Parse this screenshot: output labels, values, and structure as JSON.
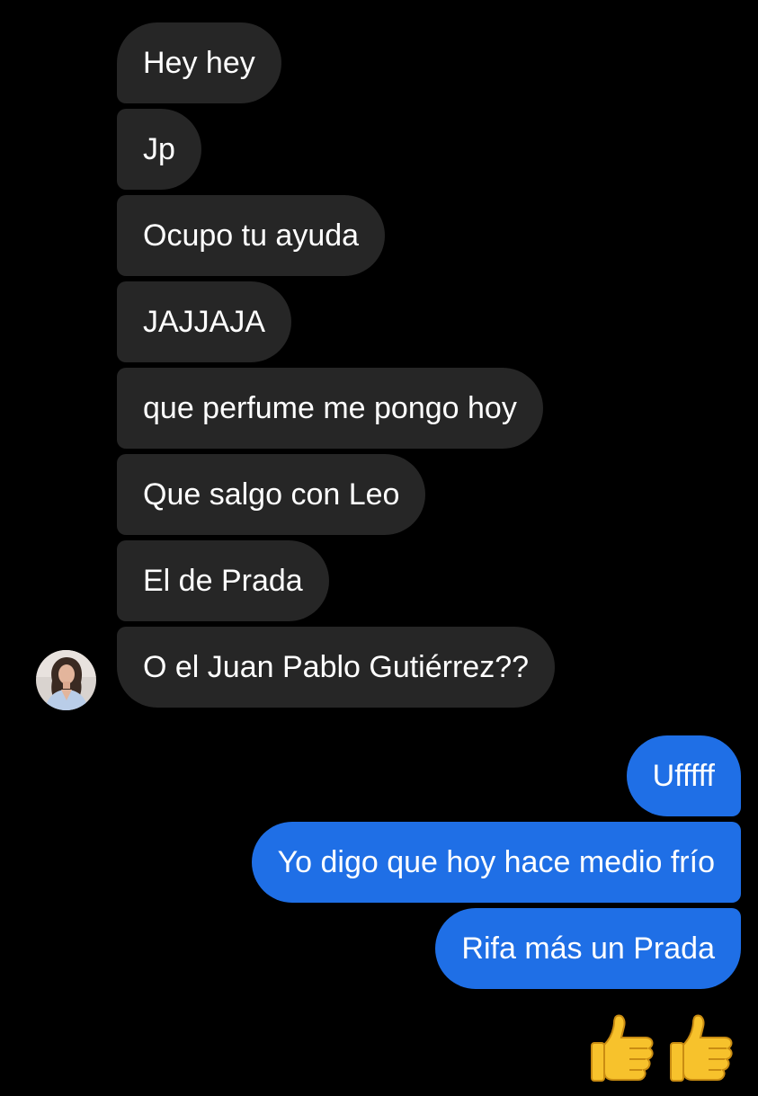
{
  "conversation": {
    "incoming": [
      {
        "text": "Hey hey"
      },
      {
        "text": "Jp"
      },
      {
        "text": "Ocupo tu ayuda"
      },
      {
        "text": "JAJJAJA"
      },
      {
        "text": "que perfume me pongo hoy"
      },
      {
        "text": "Que salgo con Leo"
      },
      {
        "text": "El de Prada"
      },
      {
        "text": "O el Juan Pablo Gutiérrez??"
      }
    ],
    "outgoing": [
      {
        "text": "Ufffff"
      },
      {
        "text": "Yo digo que hoy hace medio frío"
      },
      {
        "text": "Rifa más un Prada"
      }
    ],
    "reaction": {
      "icons": [
        "thumbs-up-icon",
        "thumbs-up-icon"
      ]
    }
  },
  "colors": {
    "background": "#000000",
    "incoming_bubble": "#262626",
    "outgoing_bubble": "#1f6fe6",
    "text": "#ffffff",
    "thumb": "#f7c22c"
  }
}
